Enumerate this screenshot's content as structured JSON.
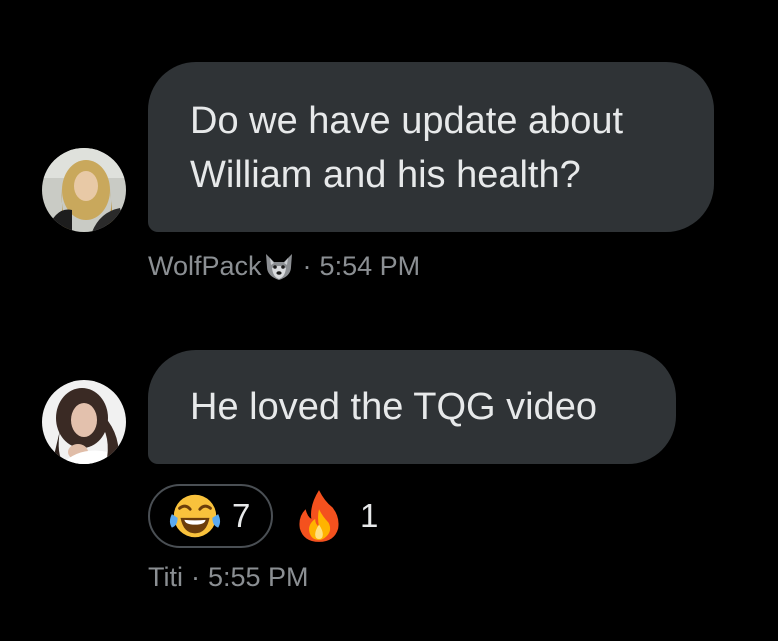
{
  "messages": [
    {
      "text": "Do we have update about\nWilliam and his health?",
      "sender": "WolfPack",
      "sender_icon": "wolf-face-icon",
      "separator": "·",
      "time": "5:54 PM"
    },
    {
      "text": "He loved the TQG video",
      "sender": "Titi",
      "separator": "·",
      "time": "5:55 PM",
      "reactions": [
        {
          "icon": "tears-of-joy-emoji-icon",
          "count": "7",
          "selected": true
        },
        {
          "icon": "fire-emoji-icon",
          "count": "1",
          "selected": false
        }
      ]
    }
  ],
  "colors": {
    "background": "#000000",
    "bubble": "#2f3336",
    "text": "#e7e9ea",
    "meta_text": "#8b8f93",
    "pill_border": "#4a4f54"
  }
}
